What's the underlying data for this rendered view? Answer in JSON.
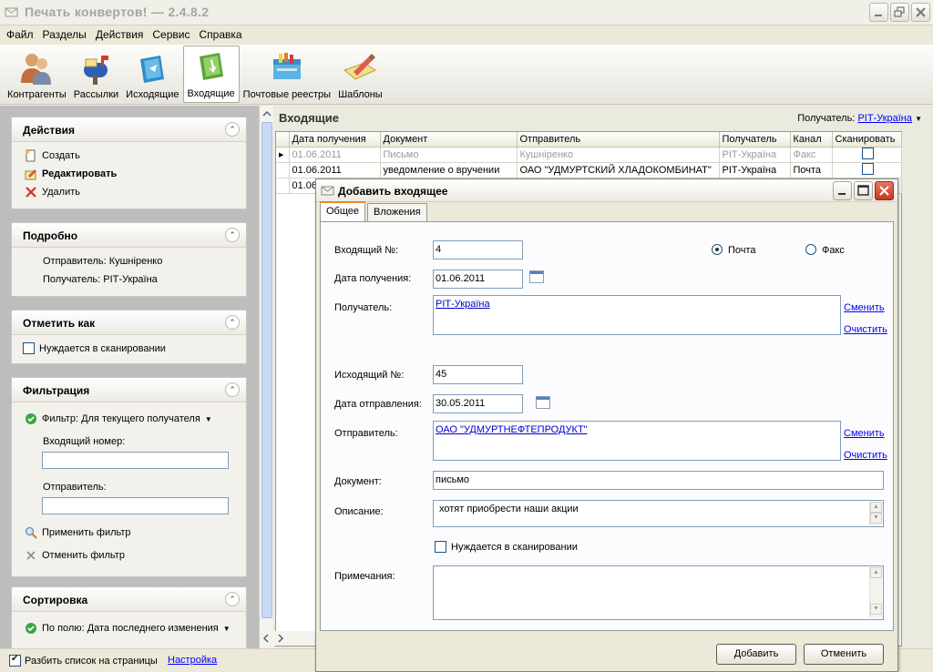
{
  "window": {
    "title": "Печать конвертов! — 2.4.8.2"
  },
  "menu": [
    "Файл",
    "Разделы",
    "Действия",
    "Сервис",
    "Справка"
  ],
  "toolbar": [
    {
      "label": "Контрагенты",
      "icon": "contacts-icon"
    },
    {
      "label": "Рассылки",
      "icon": "mailbox-icon"
    },
    {
      "label": "Исходящие",
      "icon": "outgoing-icon"
    },
    {
      "label": "Входящие",
      "icon": "incoming-icon",
      "active": true
    },
    {
      "label": "Почтовые реестры",
      "icon": "registry-icon"
    },
    {
      "label": "Шаблоны",
      "icon": "templates-icon"
    }
  ],
  "left": {
    "actions": {
      "title": "Действия",
      "create": "Создать",
      "edit": "Редактировать",
      "delete": "Удалить"
    },
    "details": {
      "title": "Подробно",
      "sender": "Отправитель: Кушніренко",
      "recipient": "Получатель: РІТ-Україна"
    },
    "mark": {
      "title": "Отметить как",
      "needs_scan": "Нуждается в сканировании"
    },
    "filter": {
      "title": "Фильтрация",
      "filter_label": "Фильтр: Для текущего получателя",
      "incoming_number_label": "Входящий номер:",
      "incoming_number_value": "",
      "sender_label": "Отправитель:",
      "sender_value": "",
      "apply": "Применить фильтр",
      "cancel": "Отменить фильтр"
    },
    "sort": {
      "title": "Сортировка",
      "by_field": "По полю: Дата последнего изменения"
    }
  },
  "status": {
    "paginate": "Разбить список на страницы",
    "settings": "Настройка"
  },
  "main": {
    "title": "Входящие",
    "recipient_label": "Получатель:",
    "recipient_value": "РІТ-Україна",
    "columns": [
      "Дата получения",
      "Документ",
      "Отправитель",
      "Получатель",
      "Канал",
      "Сканировать"
    ],
    "rows": [
      {
        "date": "01.06.2011",
        "doc": "Письмо",
        "sender": "Кушніренко",
        "recipient": "РІТ-Україна",
        "channel": "Факс",
        "scan": false
      },
      {
        "date": "01.06.2011",
        "doc": "уведомление о вручении",
        "sender": "ОАО \"УДМУРТСКИЙ ХЛАДОКОМБИНАТ\"",
        "recipient": "РІТ-Україна",
        "channel": "Почта",
        "scan": false
      },
      {
        "date": "01.06",
        "doc": "",
        "sender": "",
        "recipient": "",
        "channel": "",
        "scan": false
      }
    ]
  },
  "dialog": {
    "title": "Добавить входящее",
    "tabs": [
      "Общее",
      "Вложения"
    ],
    "incoming_no_label": "Входящий №:",
    "incoming_no": "4",
    "radio_mail": "Почта",
    "radio_fax": "Факс",
    "receive_date_label": "Дата получения:",
    "receive_date": "01.06.2011",
    "recipient_label": "Получатель:",
    "recipient": "РІТ-Україна",
    "change": "Сменить",
    "clear": "Очистить",
    "outgoing_no_label": "Исходящий №:",
    "outgoing_no": "45",
    "send_date_label": "Дата отправления:",
    "send_date": "30.05.2011",
    "sender_label": "Отправитель:",
    "sender": "ОАО \"УДМУРТНЕФТЕПРОДУКТ\"",
    "document_label": "Документ:",
    "document": "письмо",
    "description_label": "Описание:",
    "description": "хотят приобрести наши акции",
    "needs_scan": "Нуждается в сканировании",
    "notes_label": "Примечания:",
    "notes": "",
    "add": "Добавить",
    "cancel": "Отменить"
  }
}
